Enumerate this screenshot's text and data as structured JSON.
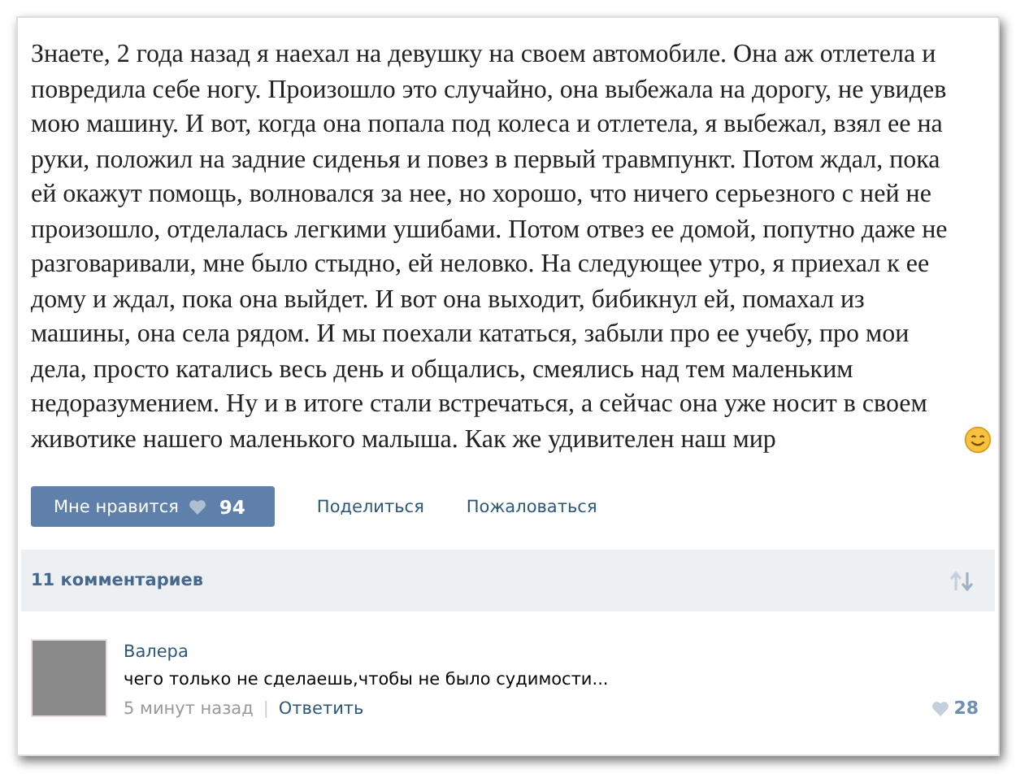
{
  "post": {
    "text": "Знаете, 2 года назад я наехал на девушку на своем автомобиле. Она аж отлетела и повредила себе ногу. Произошло это случайно, она выбежала на дорогу, не увидев мою машину. И вот, когда она попала под колеса и отлетела, я выбежал, взял ее на руки, положил на задние сиденья и повез в первый травмпункт. Потом ждал, пока ей окажут помощь, волновался за нее, но хорошо, что ничего серьезного с ней не произошло, отделалась легкими ушибами. Потом отвез ее домой, попутно даже не разговаривали, мне было стыдно, ей неловко. На следующее утро, я приехал к ее дому и ждал, пока она выйдет. И вот она выходит, бибикнул ей, помахал из машины, она села рядом. И мы поехали кататься, забыли про ее учебу, про мои дела, просто катались весь день и общались, смеялись над тем маленьким недоразумением. Ну и в итоге стали встречаться, а сейчас она уже носит в своем животике нашего маленького малыша. Как же удивителен наш мир"
  },
  "actions": {
    "like_label": "Мне нравится",
    "like_count": "94",
    "share": "Поделиться",
    "report": "Пожаловаться"
  },
  "comments_header": {
    "count": "11 комментариев"
  },
  "comments": [
    {
      "author": "Валера",
      "text": "чего только не сделаешь,чтобы не было судимости...",
      "time": "5 минут назад",
      "separator": "|",
      "reply": "Ответить",
      "likes": "28"
    }
  ]
}
